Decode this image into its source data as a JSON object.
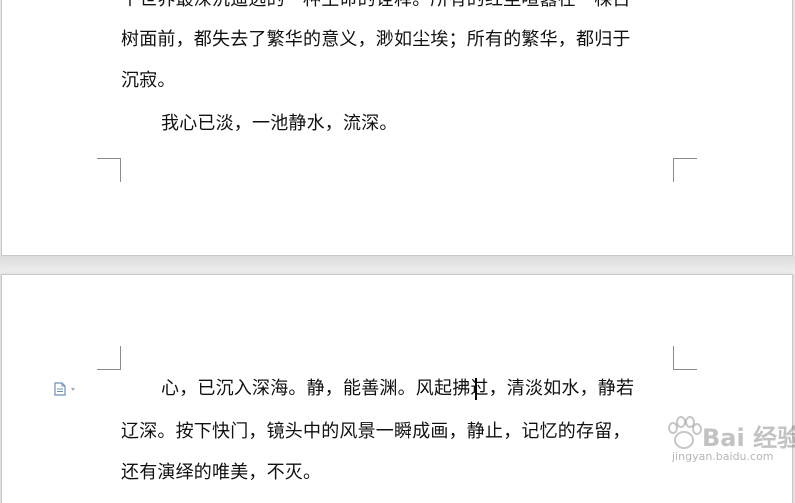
{
  "document": {
    "page1": {
      "lines": [
        "个世界最深沉遥远的一种生命的诠释。所有的红尘喧嚣在一棵古",
        "树面前，都失去了繁华的意义，渺如尘埃；所有的繁华，都归于",
        "沉寂。",
        "我心已淡，一池静水，流深。"
      ]
    },
    "page2": {
      "lines": [
        "心，已沉入深海。静，能善渊。风起拂过，清淡如水，静若",
        "辽深。按下快门，镜头中的风景一瞬成画，静止，记忆的存留，",
        "还有演绎的唯美，不灭。"
      ]
    }
  },
  "watermark": {
    "brand": "Bai 经验",
    "url": "jingyan.baidu.com"
  },
  "icons": {
    "paragraph_marker": "document-icon",
    "dropdown": "chevron-down-icon"
  },
  "colors": {
    "page": "#ffffff",
    "workspace": "#e6e6e6",
    "text": "#111111",
    "margin_mark": "#8a8a8a",
    "icon": "#6f8fb8"
  }
}
